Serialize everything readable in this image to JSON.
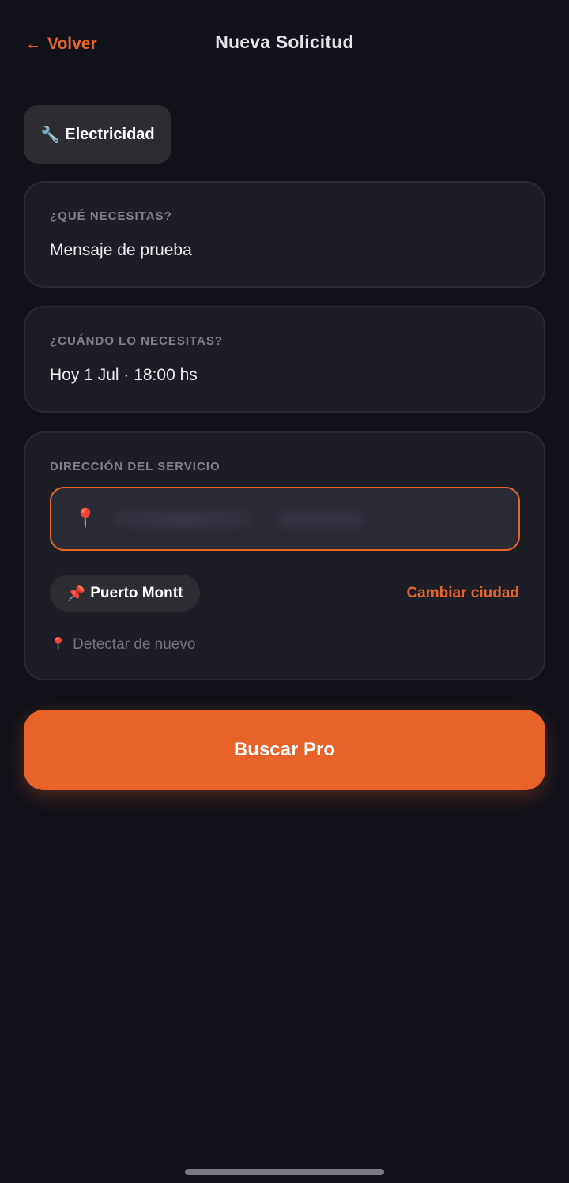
{
  "header": {
    "back_arrow": "←",
    "back_label": "Volver",
    "title": "Nueva Solicitud"
  },
  "category": {
    "icon": "🔧",
    "icon_name": "wrench-icon",
    "label": "Electricidad"
  },
  "need": {
    "label": "¿QUÉ NECESITAS?",
    "value": "Mensaje de prueba"
  },
  "when": {
    "label": "¿CUÁNDO LO NECESITAS?",
    "value": "Hoy 1 Jul · 18:00 hs"
  },
  "address": {
    "label": "DIRECCIÓN DEL SERVICIO",
    "input_icon": "📍",
    "input_icon_name": "location-pin-icon",
    "city_icon": "📌",
    "city_icon_name": "pushpin-icon",
    "city": "Puerto Montt",
    "change_city": "Cambiar ciudad",
    "detect_icon": "📍",
    "detect_again": "Detectar de nuevo"
  },
  "actions": {
    "search_label": "Buscar Pro"
  },
  "colors": {
    "accent": "#e8632a",
    "background": "#12121a",
    "card": "#1d1d25"
  }
}
